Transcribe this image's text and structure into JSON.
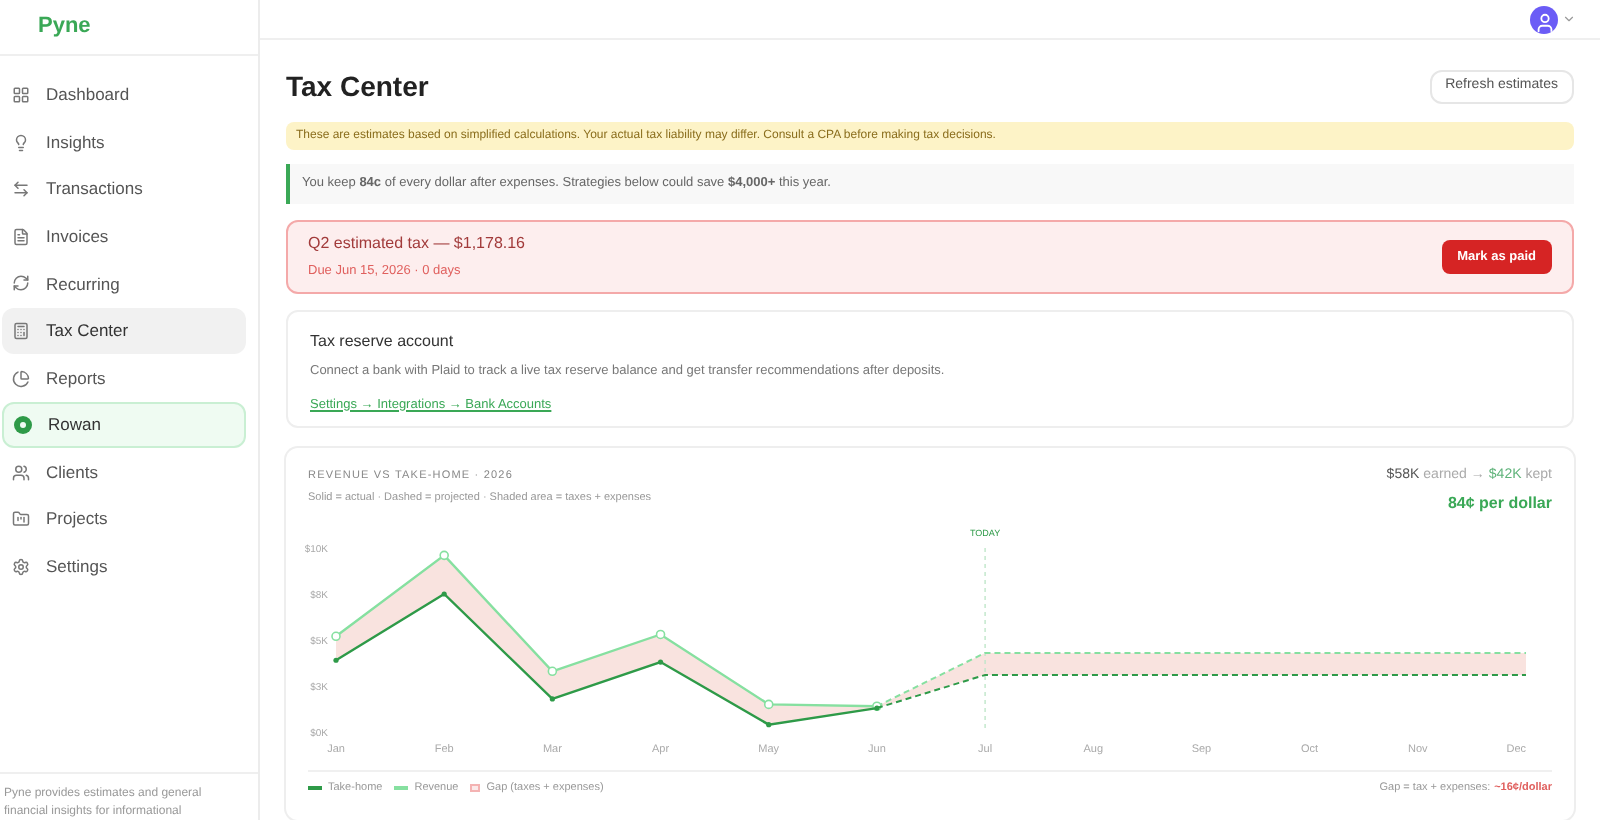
{
  "sidebar": {
    "logo": "Pyne",
    "items": [
      {
        "label": "Dashboard",
        "selected": false,
        "kind": "nav"
      },
      {
        "label": "Insights",
        "selected": false,
        "kind": "nav"
      },
      {
        "label": "Transactions",
        "selected": false,
        "kind": "nav"
      },
      {
        "label": "Invoices",
        "selected": false,
        "kind": "nav"
      },
      {
        "label": "Recurring",
        "selected": false,
        "kind": "nav"
      },
      {
        "label": "Tax Center",
        "selected": true,
        "kind": "nav"
      },
      {
        "label": "Reports",
        "selected": false,
        "kind": "nav"
      },
      {
        "label": "Rowan",
        "selected": false,
        "kind": "assistant"
      },
      {
        "label": "Clients",
        "selected": false,
        "kind": "nav"
      },
      {
        "label": "Projects",
        "selected": false,
        "kind": "nav"
      },
      {
        "label": "Settings",
        "selected": false,
        "kind": "nav"
      }
    ],
    "footer": "Pyne provides estimates and general financial insights for informational"
  },
  "page": {
    "title": "Tax Center",
    "refresh_button": "Refresh estimates",
    "disclaimer": "These are estimates based on simplified calculations. Your actual tax liability may differ. Consult a CPA before making tax decisions.",
    "insight": "You keep **84c** of every dollar after expenses. Strategies below could save **$4,000+** this year.",
    "due_card": {
      "title": "Q2 estimated tax — $1,178.16",
      "subtitle": "Due Jun 15, 2026 · 0 days",
      "button": "Mark as paid"
    },
    "reserve_card": {
      "title": "Tax reserve account",
      "text": "Connect a bank with Plaid to track a live tax reserve balance and get transfer recommendations after deposits.",
      "link": "Settings → Integrations → Bank Accounts"
    },
    "chart_card": {
      "title": "REVENUE VS TAKE-HOME · 2026",
      "subtitle": "Solid = actual · Dashed = projected · Shaded area = taxes + expenses",
      "summary_earned": "$58K",
      "summary_earned_label": "earned →",
      "summary_kept": "$42K",
      "summary_kept_label": "kept",
      "per_dollar": "84¢ per dollar",
      "chart_data": {
        "type": "line",
        "categories": [
          "Jan",
          "Feb",
          "Mar",
          "Apr",
          "May",
          "Jun",
          "Jul",
          "Aug",
          "Sep",
          "Oct",
          "Nov",
          "Dec"
        ],
        "series": [
          {
            "name": "Take-home",
            "color": "#2e9a48",
            "values": [
              3.9,
              7.5,
              1.8,
              3.8,
              0.4,
              1.3,
              3.1,
              3.1,
              3.1,
              3.1,
              3.1,
              3.1
            ]
          },
          {
            "name": "Revenue",
            "color": "#86e0a0",
            "values": [
              5.2,
              9.6,
              3.3,
              5.3,
              1.5,
              1.4,
              4.3,
              4.3,
              4.3,
              4.3,
              4.3,
              4.3
            ]
          }
        ],
        "ylim": [
          0,
          10
        ],
        "yticks": [
          {
            "value": 0,
            "label": "$0K"
          },
          {
            "value": 2.5,
            "label": "$3K"
          },
          {
            "value": 5,
            "label": "$5K"
          },
          {
            "value": 7.5,
            "label": "$8K"
          },
          {
            "value": 10,
            "label": "$10K"
          }
        ],
        "ref_lines": [
          {
            "axis": "x",
            "value": "Jul",
            "label": "TODAY"
          }
        ]
      },
      "gap_legend": "Gap (taxes + expenses)",
      "gap_note": "Gap = tax + expenses:",
      "gap_value": "~16¢/dollar"
    }
  }
}
